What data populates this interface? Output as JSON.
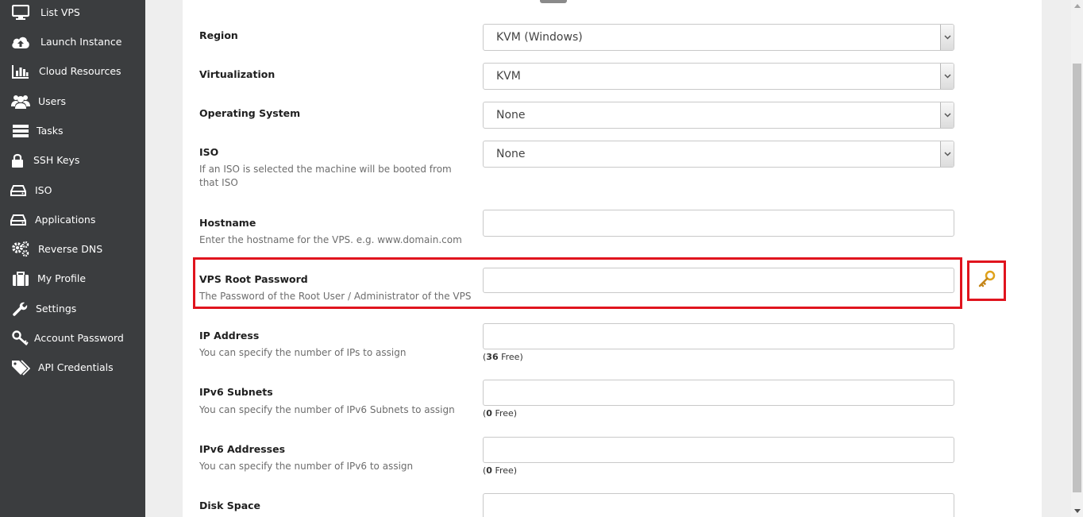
{
  "sidebar": {
    "items": [
      {
        "label": "List VPS",
        "icon": "monitor-icon"
      },
      {
        "label": "Launch Instance",
        "icon": "cloud-upload-icon"
      },
      {
        "label": "Cloud Resources",
        "icon": "bar-chart-icon"
      },
      {
        "label": "Users",
        "icon": "users-icon"
      },
      {
        "label": "Tasks",
        "icon": "tasks-icon"
      },
      {
        "label": "SSH Keys",
        "icon": "lock-icon"
      },
      {
        "label": "ISO",
        "icon": "drive-icon"
      },
      {
        "label": "Applications",
        "icon": "drive-icon"
      },
      {
        "label": "Reverse DNS",
        "icon": "gears-icon"
      },
      {
        "label": "My Profile",
        "icon": "briefcase-icon"
      },
      {
        "label": "Settings",
        "icon": "wrench-icon"
      },
      {
        "label": "Account Password",
        "icon": "key-wrench-icon"
      },
      {
        "label": "API Credentials",
        "icon": "tags-icon"
      }
    ]
  },
  "form": {
    "region": {
      "label": "Region",
      "value": "KVM (Windows)"
    },
    "virtualization": {
      "label": "Virtualization",
      "value": "KVM"
    },
    "os": {
      "label": "Operating System",
      "value": "None"
    },
    "iso": {
      "label": "ISO",
      "help": "If an ISO is selected the machine will be booted from that ISO",
      "value": "None"
    },
    "hostname": {
      "label": "Hostname",
      "help": "Enter the hostname for the VPS. e.g. www.domain.com",
      "value": ""
    },
    "root_password": {
      "label": "VPS Root Password",
      "help": "The Password of the Root User / Administrator of the VPS",
      "value": ""
    },
    "ip_address": {
      "label": "IP Address",
      "help": "You can specify the number of IPs to assign",
      "value": "",
      "free_count": "36",
      "free_label": " Free)"
    },
    "ipv6_subnets": {
      "label": "IPv6 Subnets",
      "help": "You can specify the number of IPv6 Subnets to assign",
      "value": "",
      "free_count": "0",
      "free_label": " Free)"
    },
    "ipv6_addresses": {
      "label": "IPv6 Addresses",
      "help": "You can specify the number of IPv6 to assign",
      "value": "",
      "free_count": "0",
      "free_label": " Free)"
    },
    "disk_space": {
      "label": "Disk Space",
      "value": ""
    }
  },
  "colors": {
    "sidebar_bg": "#3b3d3f",
    "highlight": "#e0141e",
    "key_icon": "#e0a21a"
  }
}
